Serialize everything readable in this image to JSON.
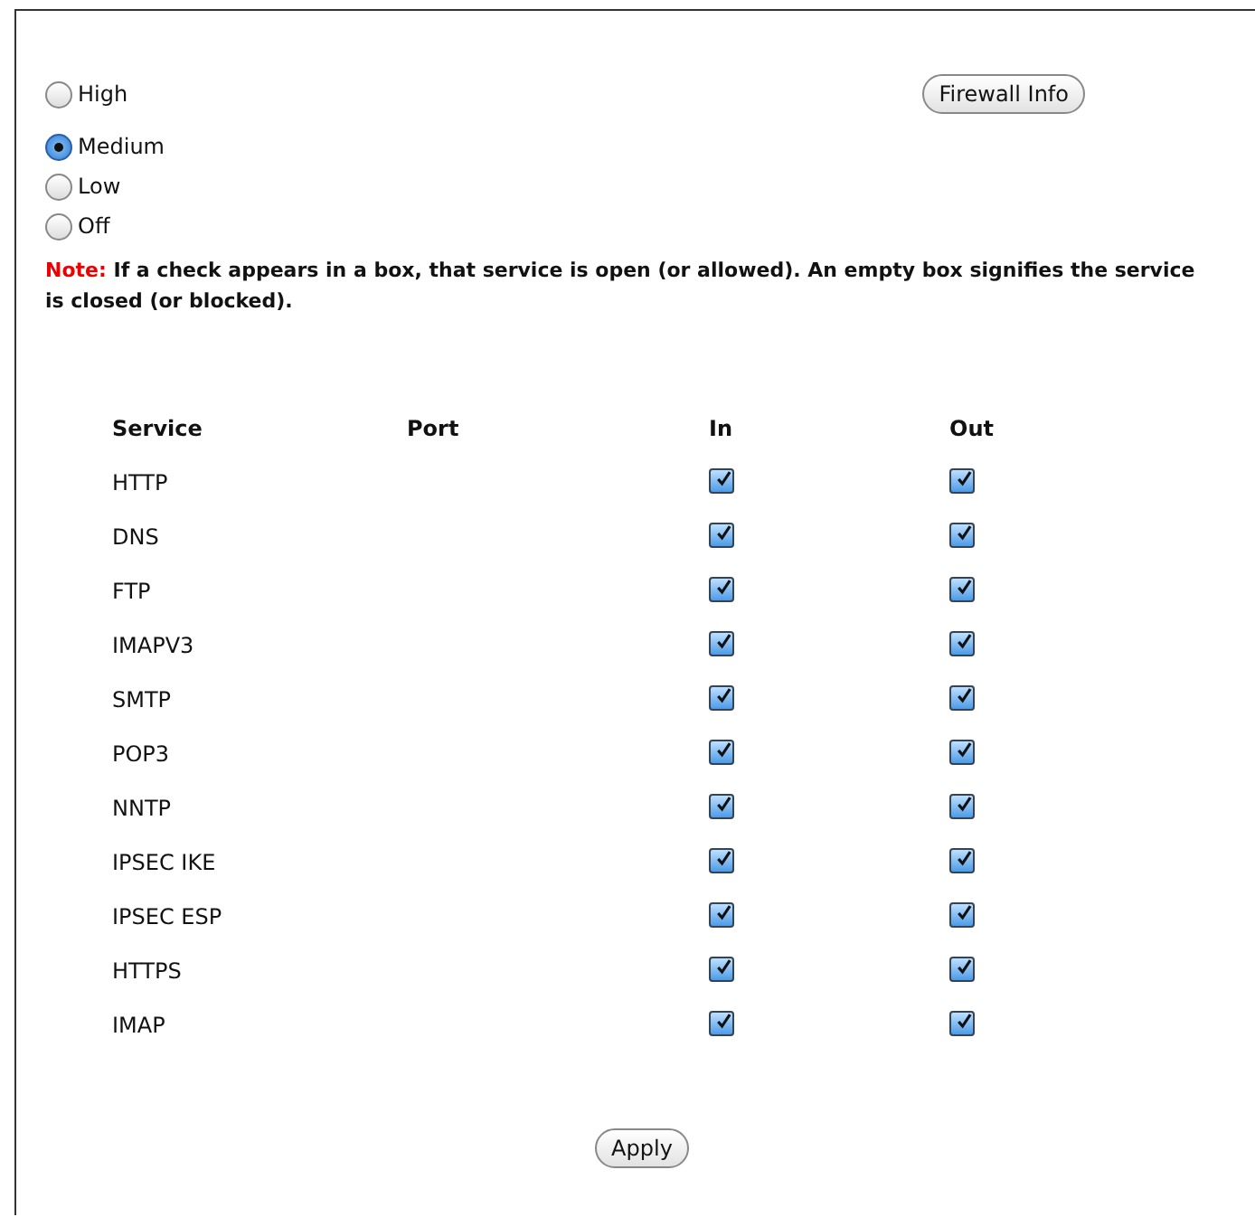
{
  "levels": [
    {
      "label": "High",
      "selected": false
    },
    {
      "label": "Medium",
      "selected": true
    },
    {
      "label": "Low",
      "selected": false
    },
    {
      "label": "Off",
      "selected": false
    }
  ],
  "info_button": "Firewall Info",
  "note": {
    "label": "Note:",
    "text": "If a check appears in a box, that service is open (or allowed). An empty box signifies the service is closed (or blocked)."
  },
  "table": {
    "columns": [
      "Service",
      "Port",
      "In",
      "Out"
    ],
    "rows": [
      {
        "service": "HTTP",
        "in": true,
        "out": true
      },
      {
        "service": "DNS",
        "in": true,
        "out": true
      },
      {
        "service": "FTP",
        "in": true,
        "out": true
      },
      {
        "service": "IMAPV3",
        "in": true,
        "out": true
      },
      {
        "service": "SMTP",
        "in": true,
        "out": true
      },
      {
        "service": "POP3",
        "in": true,
        "out": true
      },
      {
        "service": "NNTP",
        "in": true,
        "out": true
      },
      {
        "service": "IPSEC IKE",
        "in": true,
        "out": true
      },
      {
        "service": "IPSEC ESP",
        "in": true,
        "out": true
      },
      {
        "service": "HTTPS",
        "in": true,
        "out": true
      },
      {
        "service": "IMAP",
        "in": true,
        "out": true
      }
    ]
  },
  "apply_button": "Apply"
}
